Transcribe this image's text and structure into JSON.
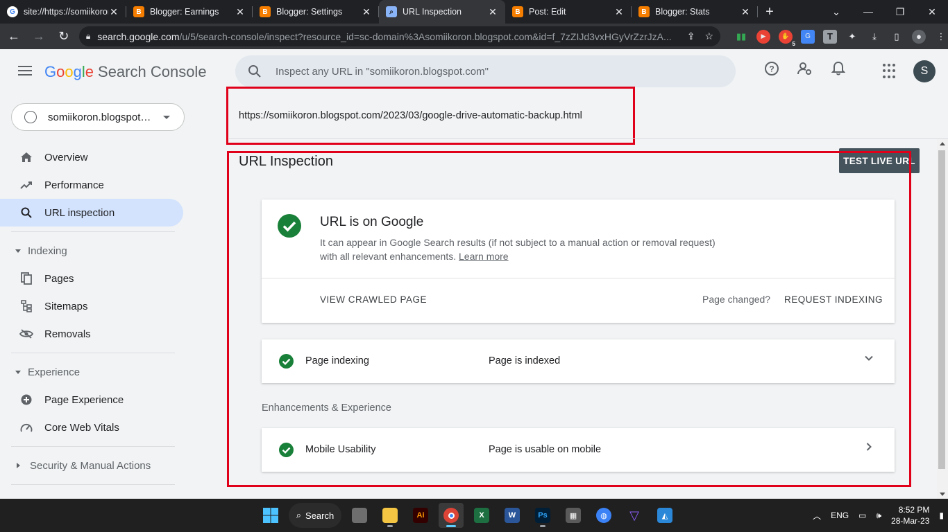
{
  "browser": {
    "tabs": [
      {
        "title": "site://https://somiikoron",
        "favicon": "google-g-icon",
        "active": false
      },
      {
        "title": "Blogger: Earnings",
        "favicon": "blogger-icon",
        "active": false
      },
      {
        "title": "Blogger: Settings",
        "favicon": "blogger-icon",
        "active": false
      },
      {
        "title": "URL Inspection",
        "favicon": "search-console-icon",
        "active": true
      },
      {
        "title": "Post: Edit",
        "favicon": "blogger-icon",
        "active": false
      },
      {
        "title": "Blogger: Stats",
        "favicon": "blogger-icon",
        "active": false
      }
    ],
    "address": {
      "host": "search.google.com",
      "path": "/u/5/search-console/inspect?resource_id=sc-domain%3Asomiikoron.blogspot.com&id=f_7zZIJd3vxHGyVrZzrJzA..."
    },
    "extension_badge": "5"
  },
  "header": {
    "logo_google": [
      "G",
      "o",
      "o",
      "g",
      "l",
      "e"
    ],
    "logo_product": "Search Console",
    "search_placeholder": "Inspect any URL in \"somiikoron.blogspot.com\"",
    "avatar_letter": "S"
  },
  "sidebar": {
    "property": "somiikoron.blogspot.com",
    "items": {
      "overview": "Overview",
      "performance": "Performance",
      "url_inspection": "URL inspection",
      "indexing": "Indexing",
      "pages": "Pages",
      "sitemaps": "Sitemaps",
      "removals": "Removals",
      "experience": "Experience",
      "page_experience": "Page Experience",
      "core_web_vitals": "Core Web Vitals",
      "security": "Security & Manual Actions"
    }
  },
  "main": {
    "inspected_url": "https://somiikoron.blogspot.com/2023/03/google-drive-automatic-backup.html",
    "title": "URL Inspection",
    "test_live_label": "TEST LIVE URL",
    "status": {
      "heading": "URL is on Google",
      "description": "It can appear in Google Search results (if not subject to a manual action or removal request) with all relevant enhancements.",
      "learn_more": "Learn more",
      "view_crawled": "VIEW CRAWLED PAGE",
      "page_changed": "Page changed?",
      "request_indexing": "REQUEST INDEXING"
    },
    "page_indexing": {
      "label": "Page indexing",
      "value": "Page is indexed"
    },
    "enhancements_heading": "Enhancements & Experience",
    "mobile_usability": {
      "label": "Mobile Usability",
      "value": "Page is usable on mobile"
    }
  },
  "taskbar": {
    "search_label": "Search",
    "language": "ENG",
    "time": "8:52 PM",
    "date": "28-Mar-23"
  },
  "colors": {
    "success_green": "#188038",
    "highlight_red": "#e0001a",
    "active_nav": "#d3e3fd",
    "primary_button": "#45535c"
  }
}
